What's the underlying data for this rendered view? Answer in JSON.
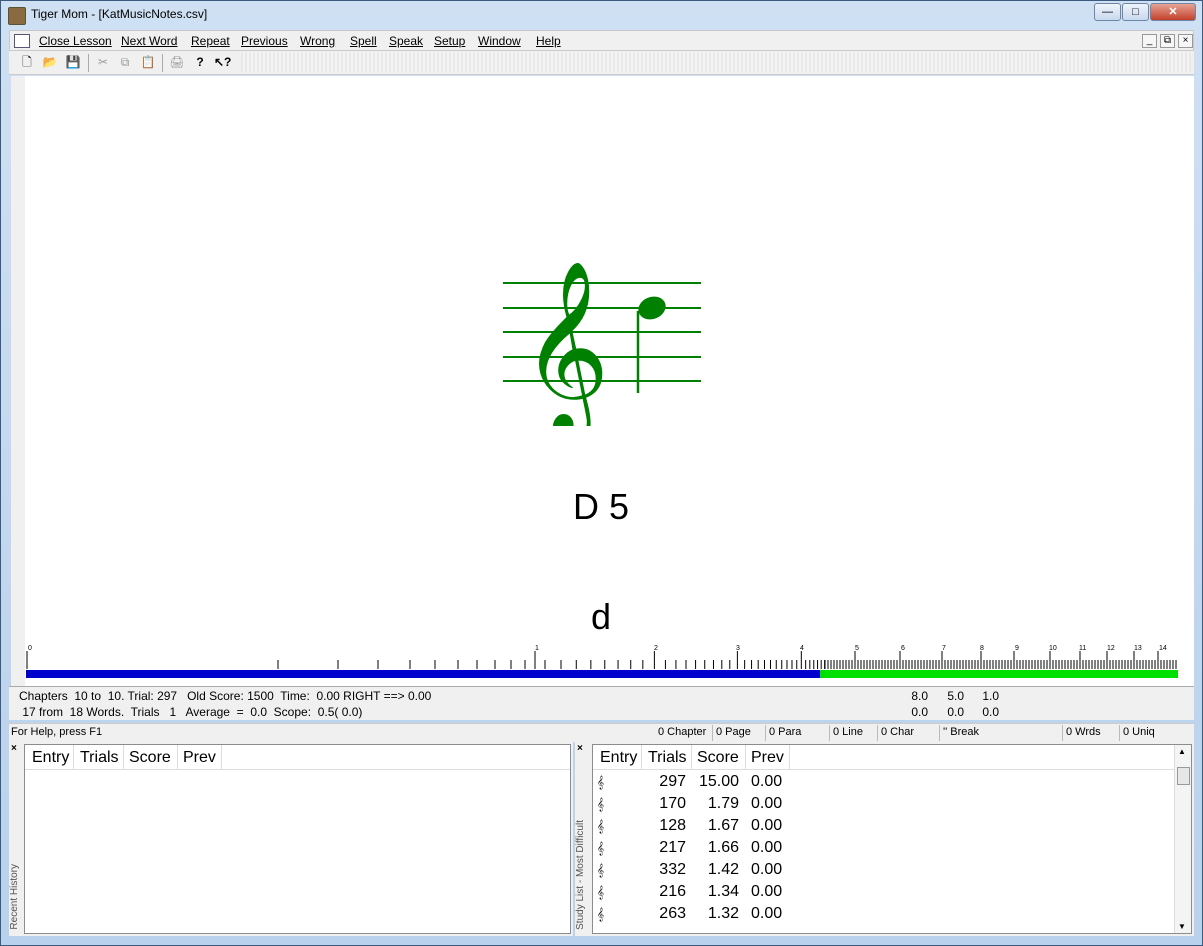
{
  "window": {
    "title": "Tiger Mom - [KatMusicNotes.csv]"
  },
  "menu": [
    "Close Lesson",
    "Next Word",
    "Repeat",
    "Previous",
    "Wrong",
    "Spell",
    "Speak",
    "Setup",
    "Window",
    "Help"
  ],
  "toolbar": {
    "icons": [
      "new-file-icon",
      "open-folder-icon",
      "save-icon",
      "cut-icon",
      "copy-icon",
      "paste-icon",
      "print-icon",
      "help-icon",
      "context-help-icon"
    ]
  },
  "display": {
    "note_name": "D 5",
    "answer": "d",
    "staff_color": "#008000",
    "progress_right_color": "#00e000",
    "progress_left_color": "#0000cc"
  },
  "ruler": {
    "labels": [
      "0",
      "1",
      "2",
      "3",
      "4",
      "5",
      "6",
      "7",
      "8",
      "9",
      "10",
      "11",
      "12",
      "13",
      "14"
    ]
  },
  "status": {
    "line1": "Chapters  10 to  10. Trial: 297   Old Score: 1500  Time:  0.00 RIGHT ==> 0.00",
    "line2": " 17 from  18 Words.  Trials   1   Average  =  0.0  Scope:  0.5( 0.0)",
    "nums_row1": [
      "8.0",
      "5.0",
      "1.0"
    ],
    "nums_row2": [
      "0.0",
      "0.0",
      "0.0"
    ]
  },
  "statusbar": {
    "help": "For Help, press F1",
    "chapter": "0 Chapter",
    "page": "0 Page",
    "para": "0 Para",
    "line": "0 Line",
    "char": "0 Char",
    "break": "'' Break",
    "wrds": "0 Wrds",
    "uniq": "0 Uniq"
  },
  "recent_history": {
    "label": "Recent History",
    "columns": [
      "Entry",
      "Trials",
      "Score",
      "Prev"
    ]
  },
  "study_list": {
    "label": "Study List - Most Difficult",
    "columns": [
      "Entry",
      "Trials",
      "Score",
      "Prev"
    ],
    "rows": [
      {
        "trials": "297",
        "score": "15.00",
        "prev": "0.00"
      },
      {
        "trials": "170",
        "score": "1.79",
        "prev": "0.00"
      },
      {
        "trials": "128",
        "score": "1.67",
        "prev": "0.00"
      },
      {
        "trials": "217",
        "score": "1.66",
        "prev": "0.00"
      },
      {
        "trials": "332",
        "score": "1.42",
        "prev": "0.00"
      },
      {
        "trials": "216",
        "score": "1.34",
        "prev": "0.00"
      },
      {
        "trials": "263",
        "score": "1.32",
        "prev": "0.00"
      }
    ]
  }
}
